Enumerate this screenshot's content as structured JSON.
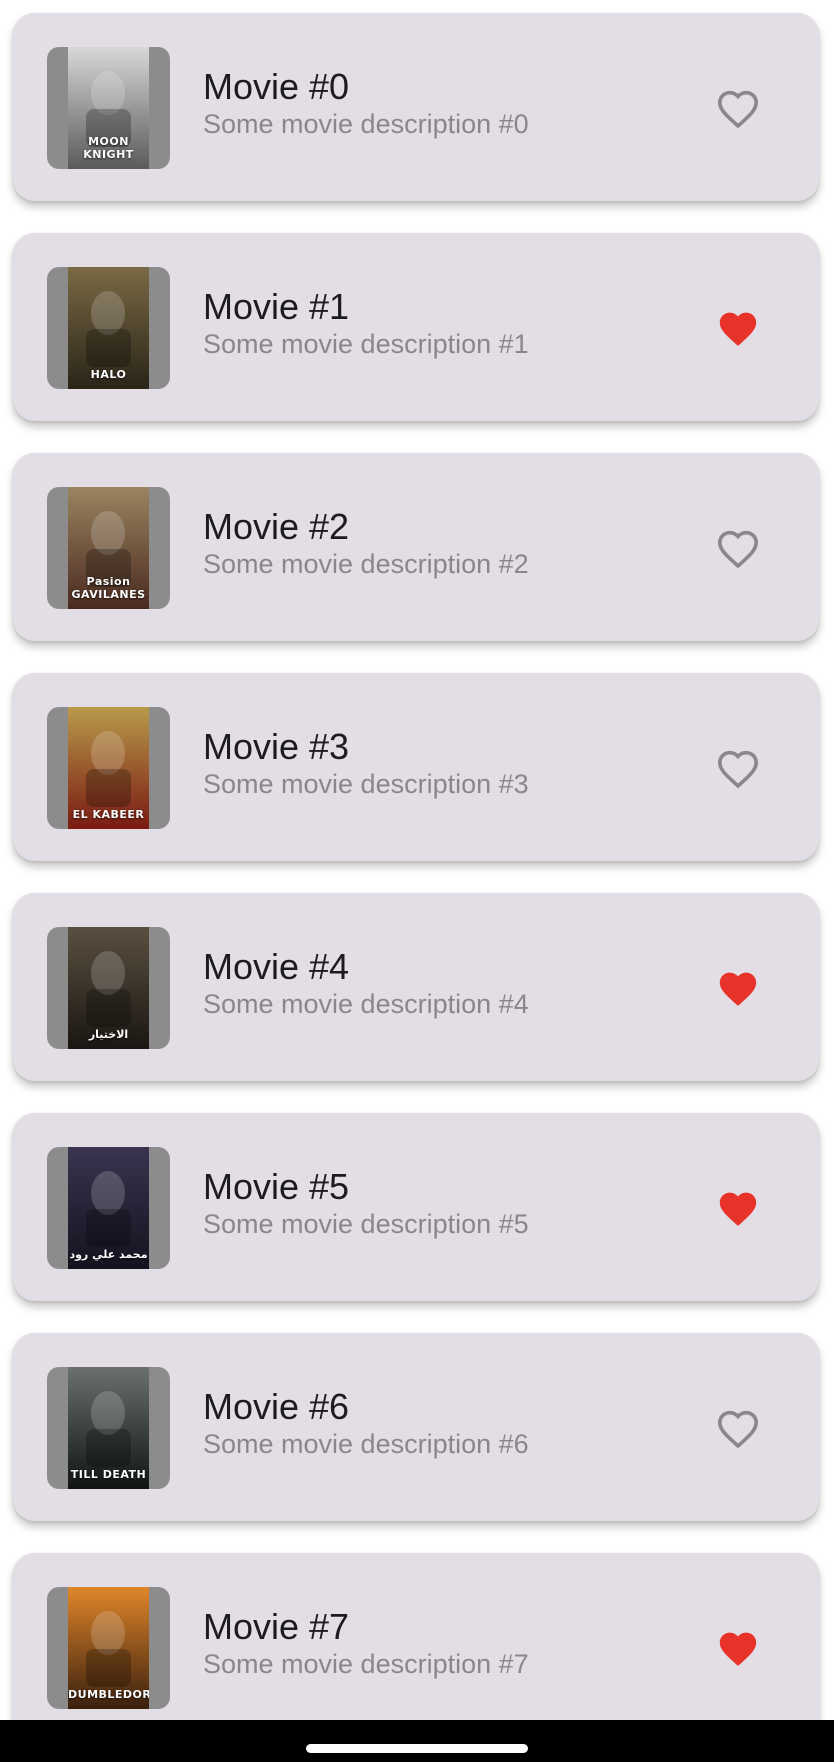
{
  "movies": [
    {
      "title": "Movie #0",
      "description": "Some movie description #0",
      "poster_caption": "MOON KNIGHT",
      "poster_colors": [
        "#d8d8d8",
        "#5a5a5a"
      ],
      "favorite": false,
      "favorite_icon": "heart-outline-icon"
    },
    {
      "title": "Movie #1",
      "description": "Some movie description #1",
      "poster_caption": "HALO",
      "poster_colors": [
        "#7a6a45",
        "#2a2418"
      ],
      "favorite": true,
      "favorite_icon": "heart-filled-icon"
    },
    {
      "title": "Movie #2",
      "description": "Some movie description #2",
      "poster_caption": "Pasion GAVILANES",
      "poster_colors": [
        "#9a8460",
        "#4a2a20"
      ],
      "favorite": false,
      "favorite_icon": "heart-outline-icon"
    },
    {
      "title": "Movie #3",
      "description": "Some movie description #3",
      "poster_caption": "EL KABEER",
      "poster_colors": [
        "#b89a4a",
        "#7a1a12"
      ],
      "favorite": false,
      "favorite_icon": "heart-outline-icon"
    },
    {
      "title": "Movie #4",
      "description": "Some movie description #4",
      "poster_caption": "الاختيار",
      "poster_colors": [
        "#5a5040",
        "#1a1612"
      ],
      "favorite": true,
      "favorite_icon": "heart-filled-icon"
    },
    {
      "title": "Movie #5",
      "description": "Some movie description #5",
      "poster_caption": "محمد علي رود",
      "poster_colors": [
        "#3a3450",
        "#14121e"
      ],
      "favorite": true,
      "favorite_icon": "heart-filled-icon"
    },
    {
      "title": "Movie #6",
      "description": "Some movie description #6",
      "poster_caption": "TILL DEATH",
      "poster_colors": [
        "#6a7070",
        "#101414"
      ],
      "favorite": false,
      "favorite_icon": "heart-outline-icon"
    },
    {
      "title": "Movie #7",
      "description": "Some movie description #7",
      "poster_caption": "DUMBLEDORE",
      "poster_colors": [
        "#e0862a",
        "#3a200e"
      ],
      "favorite": true,
      "favorite_icon": "heart-filled-icon"
    }
  ],
  "colors": {
    "card_background": "#e3dee5",
    "favorite_active": "#e8332a",
    "favorite_inactive": "#8a878c"
  }
}
